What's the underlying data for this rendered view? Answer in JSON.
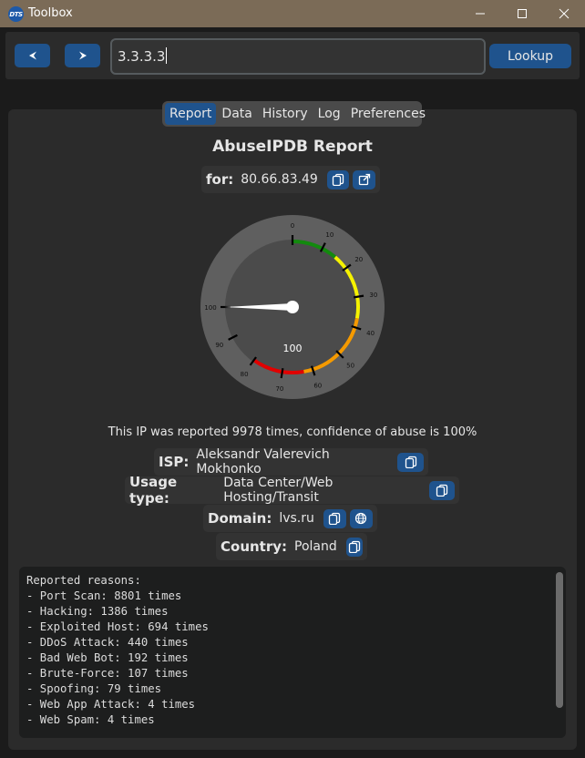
{
  "window": {
    "app_icon_text": "DTS",
    "title": "Toolbox"
  },
  "toolbar": {
    "address_value": "3.3.3.3",
    "lookup_label": "Lookup"
  },
  "tabs": [
    {
      "label": "Report",
      "active": true
    },
    {
      "label": "Data",
      "active": false
    },
    {
      "label": "History",
      "active": false
    },
    {
      "label": "Log",
      "active": false
    },
    {
      "label": "Preferences",
      "active": false
    }
  ],
  "report": {
    "title": "AbuseIPDB Report",
    "for_label": "for:",
    "for_value": "80.66.83.49",
    "summary": "This IP was reported 9978 times, confidence of abuse is 100%",
    "isp_label": "ISP:",
    "isp_value": "Aleksandr Valerevich Mokhonko",
    "usage_label": "Usage type:",
    "usage_value": "Data Center/Web Hosting/Transit",
    "domain_label": "Domain:",
    "domain_value": "lvs.ru",
    "country_label": "Country:",
    "country_value": "Poland"
  },
  "gauge": {
    "value": 100,
    "value_text": "100",
    "ticks": [
      "0",
      "10",
      "20",
      "30",
      "40",
      "50",
      "60",
      "70",
      "80",
      "90",
      "100"
    ],
    "colors": {
      "green": "#138a0e",
      "yellow": "#f5f200",
      "orange": "#f59a00",
      "red": "#e10000"
    }
  },
  "reasons": {
    "text": "Reported reasons:\n- Port Scan: 8801 times\n- Hacking: 1386 times\n- Exploited Host: 694 times\n- DDoS Attack: 440 times\n- Bad Web Bot: 192 times\n- Brute-Force: 107 times\n- Spoofing: 79 times\n- Web App Attack: 4 times\n- Web Spam: 4 times"
  },
  "icons": {
    "back": "back-arrow-icon",
    "forward": "forward-arrow-icon",
    "copy": "copy-icon",
    "open_link": "open-external-icon",
    "globe": "globe-icon"
  },
  "accent": "#1f538d"
}
